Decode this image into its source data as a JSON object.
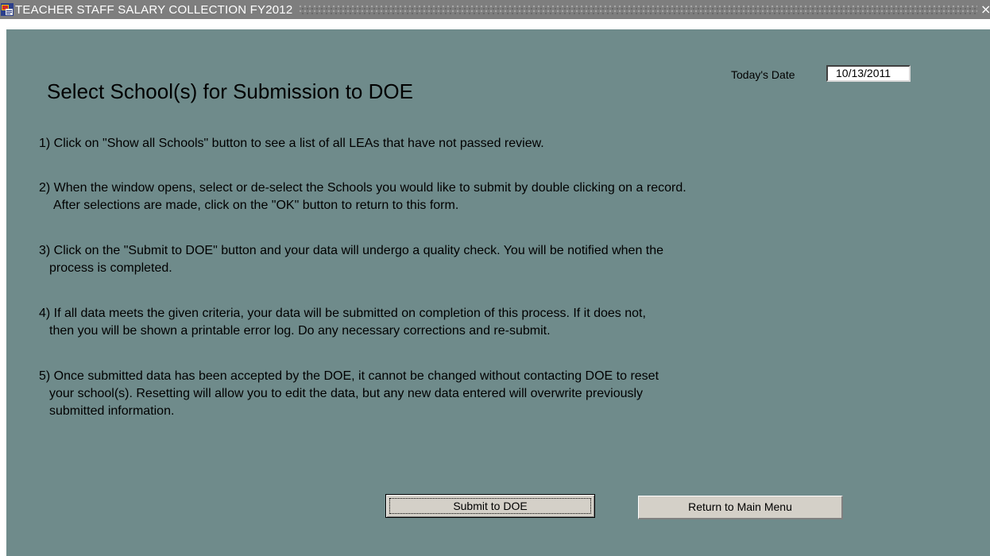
{
  "window": {
    "title": "TEACHER STAFF SALARY COLLECTION FY2012",
    "close_glyph": "×"
  },
  "form": {
    "heading": "Select School(s) for Submission to DOE",
    "date_label": "Today's Date",
    "date_value": "10/13/2011",
    "steps": [
      {
        "line1": "1)  Click on \"Show all Schools\" button to see a list of all LEAs that have not passed review.",
        "line2": ""
      },
      {
        "line1": "2) When the window opens, select or de-select the Schools you would like to submit by double clicking on a record.",
        "line2": "  After selections are made, click on the \"OK\" button to return to this form."
      },
      {
        "line1": "3) Click on the \"Submit to DOE\"  button and your data will undergo a quality check.   You will be notified when the",
        "line2": "process is completed."
      },
      {
        "line1": "4) If all data meets the given criteria, your data will be submitted on completion of this process.  If it  does not,",
        "line2": "then you will be shown a printable error log.  Do any necessary corrections and re-submit."
      },
      {
        "line1": "5) Once submitted data has been accepted by the DOE, it cannot be changed without contacting DOE to reset",
        "line2": "your school(s).  Resetting will allow you to edit the data, but any new data entered will overwrite previously",
        "line3": "submitted information."
      }
    ],
    "buttons": {
      "submit_label": "Submit to DOE",
      "return_label": "Return to Main Menu"
    }
  },
  "colors": {
    "form_background": "#6f8b8b",
    "titlebar_background": "#7e7e7e",
    "button_face": "#d4d0c8"
  }
}
